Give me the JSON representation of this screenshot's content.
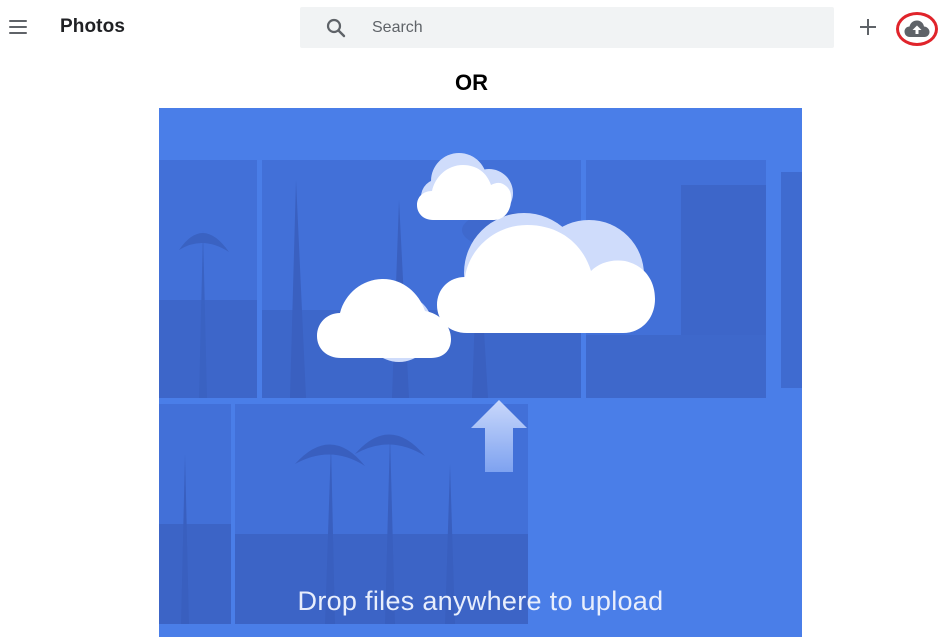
{
  "header": {
    "app_title": "Photos",
    "search": {
      "placeholder": "Search",
      "value": ""
    },
    "icons": {
      "menu": "menu-icon",
      "search": "search-icon",
      "create": "plus-icon",
      "upload": "cloud-upload-icon"
    }
  },
  "annotation": {
    "label": "OR"
  },
  "dropzone": {
    "message": "Drop files anywhere to upload"
  },
  "colors": {
    "dropzone_bg": "#4a7ee8",
    "tile_bg": "#4270d8",
    "highlight_ring": "#e0242b",
    "search_bg": "#f1f3f4"
  }
}
